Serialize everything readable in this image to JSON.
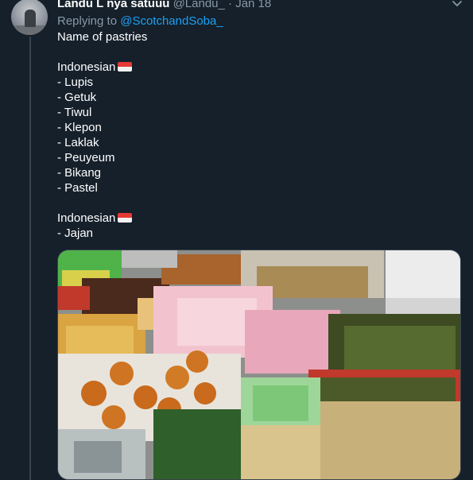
{
  "tweet": {
    "display_name": "Landu L nya satuuu",
    "handle": "@Landu_",
    "separator": "·",
    "date": "Jan 18",
    "replying_prefix": "Replying to",
    "replying_to": "@ScotchandSoba_",
    "lines": [
      "Name of pastries",
      "",
      "Indonesian",
      "- Lupis",
      "- Getuk",
      "- Tiwul",
      "- Klepon",
      "- Laklak",
      "- Peuyeum",
      "- Bikang",
      "- Pastel",
      "",
      "Indonesian",
      "- Jajan"
    ],
    "flag_lines": [
      2,
      12
    ]
  },
  "colors": {
    "background": "#15202b",
    "text": "#ffffff",
    "muted": "#8899a6",
    "link": "#1da1f2",
    "border": "#38444d"
  },
  "icons": {
    "caret": "chevron-down-icon",
    "flag": "indonesia-flag-icon"
  }
}
